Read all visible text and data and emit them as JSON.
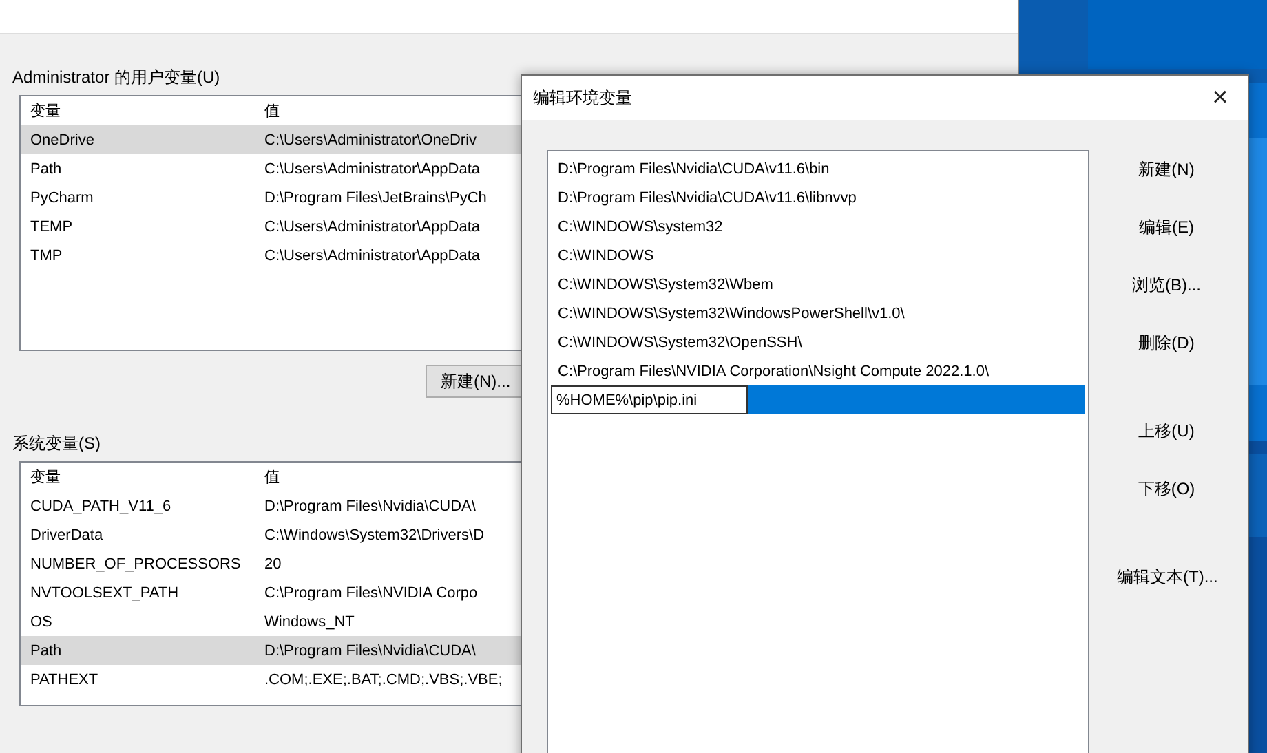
{
  "user_vars": {
    "label": "Administrator 的用户变量(U)",
    "columns": [
      "变量",
      "值"
    ],
    "rows": [
      {
        "name": "OneDrive",
        "value": "C:\\Users\\Administrator\\OneDriv",
        "selected": true
      },
      {
        "name": "Path",
        "value": "C:\\Users\\Administrator\\AppData",
        "selected": false
      },
      {
        "name": "PyCharm",
        "value": "D:\\Program Files\\JetBrains\\PyCh",
        "selected": false
      },
      {
        "name": "TEMP",
        "value": "C:\\Users\\Administrator\\AppData",
        "selected": false
      },
      {
        "name": "TMP",
        "value": "C:\\Users\\Administrator\\AppData",
        "selected": false
      }
    ],
    "buttons": [
      "新建(N)..."
    ]
  },
  "system_vars": {
    "label": "系统变量(S)",
    "columns": [
      "变量",
      "值"
    ],
    "rows": [
      {
        "name": "CUDA_PATH_V11_6",
        "value": "D:\\Program Files\\Nvidia\\CUDA\\",
        "selected": false
      },
      {
        "name": "DriverData",
        "value": "C:\\Windows\\System32\\Drivers\\D",
        "selected": false
      },
      {
        "name": "NUMBER_OF_PROCESSORS",
        "value": "20",
        "selected": false
      },
      {
        "name": "NVTOOLSEXT_PATH",
        "value": "C:\\Program Files\\NVIDIA Corpo",
        "selected": false
      },
      {
        "name": "OS",
        "value": "Windows_NT",
        "selected": false
      },
      {
        "name": "Path",
        "value": "D:\\Program Files\\Nvidia\\CUDA\\",
        "selected": true
      },
      {
        "name": "PATHEXT",
        "value": ".COM;.EXE;.BAT;.CMD;.VBS;.VBE;",
        "selected": false
      }
    ]
  },
  "dialog": {
    "title": "编辑环境变量",
    "close": "×",
    "entries": [
      {
        "text": "D:\\Program Files\\Nvidia\\CUDA\\v11.6\\bin",
        "selected": false,
        "editing": false
      },
      {
        "text": "D:\\Program Files\\Nvidia\\CUDA\\v11.6\\libnvvp",
        "selected": false,
        "editing": false
      },
      {
        "text": "C:\\WINDOWS\\system32",
        "selected": false,
        "editing": false
      },
      {
        "text": "C:\\WINDOWS",
        "selected": false,
        "editing": false
      },
      {
        "text": "C:\\WINDOWS\\System32\\Wbem",
        "selected": false,
        "editing": false
      },
      {
        "text": "C:\\WINDOWS\\System32\\WindowsPowerShell\\v1.0\\",
        "selected": false,
        "editing": false
      },
      {
        "text": "C:\\WINDOWS\\System32\\OpenSSH\\",
        "selected": false,
        "editing": false
      },
      {
        "text": "C:\\Program Files\\NVIDIA Corporation\\Nsight Compute 2022.1.0\\",
        "selected": false,
        "editing": false
      },
      {
        "text": "%HOME%\\pip\\pip.ini",
        "selected": true,
        "editing": true
      }
    ],
    "button_groups": [
      [
        "新建(N)",
        "编辑(E)",
        "浏览(B)...",
        "删除(D)"
      ],
      [
        "上移(U)",
        "下移(O)"
      ],
      [
        "编辑文本(T)..."
      ]
    ]
  }
}
